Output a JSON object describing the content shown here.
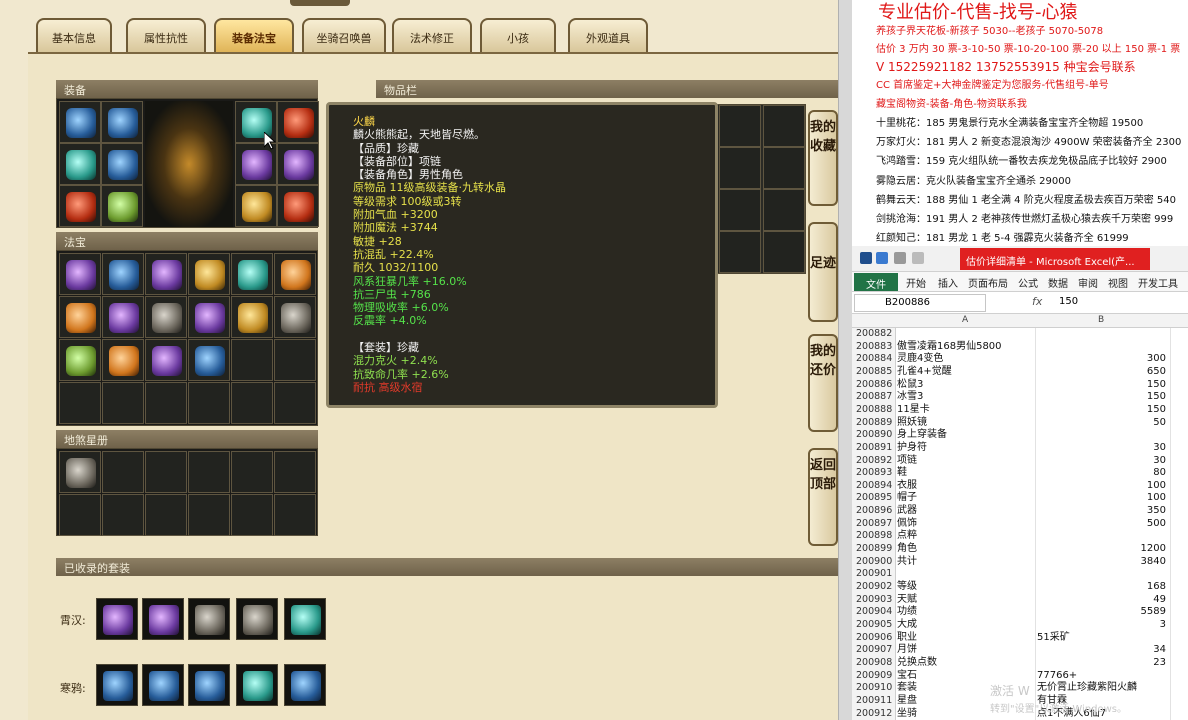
{
  "game": {
    "tabs": [
      "基本信息",
      "属性抗性",
      "装备法宝",
      "坐骑召唤兽",
      "法术修正",
      "小孩",
      "外观道具"
    ],
    "active_tab": 2,
    "sections": {
      "equip": "装备",
      "inventory": "物品栏",
      "fabao": "法宝",
      "star": "地煞星册",
      "suits": "已收录的套装"
    },
    "side_buttons": [
      "我的收藏",
      "足迹",
      "我的还价",
      "返回顶部"
    ],
    "suit_rows": [
      {
        "label": "霄汉:",
        "icons": [
          "purple",
          "purple",
          "grey",
          "grey",
          "teal"
        ]
      },
      {
        "label": "寒鸦:",
        "icons": [
          "blue",
          "blue",
          "blue",
          "teal",
          "blue"
        ]
      }
    ],
    "tooltip": [
      {
        "text": "火麟",
        "color": "y"
      },
      {
        "text": "麟火熊熊起，天地皆尽燃。",
        "color": "w"
      },
      {
        "text": "【品质】珍藏",
        "color": "w"
      },
      {
        "text": "【装备部位】项链",
        "color": "w"
      },
      {
        "text": "【装备角色】男性角色",
        "color": "w"
      },
      {
        "text": "原物品 11级高级装备·九转水晶",
        "color": "yel"
      },
      {
        "text": "等级需求 100级或3转",
        "color": "yel"
      },
      {
        "text": "附加气血 +3200",
        "color": "yel"
      },
      {
        "text": "附加魔法 +3744",
        "color": "yel"
      },
      {
        "text": "敏捷 +28",
        "color": "yel"
      },
      {
        "text": "抗混乱 +22.4%",
        "color": "yel"
      },
      {
        "text": "耐久 1032/1100",
        "color": "yel"
      },
      {
        "text": "风系狂暴几率 +16.0%",
        "color": "g"
      },
      {
        "text": "抗三尸虫 +786",
        "color": "g"
      },
      {
        "text": "物理吸收率 +6.0%",
        "color": "g"
      },
      {
        "text": "反震率 +4.0%",
        "color": "g"
      },
      {
        "text": "",
        "color": "w"
      },
      {
        "text": "【套装】珍藏",
        "color": "w"
      },
      {
        "text": "混力克火 +2.4%",
        "color": "gs"
      },
      {
        "text": "抗致命几率 +2.6%",
        "color": "gs"
      },
      {
        "text": "耐抗 高级水宿",
        "color": "r"
      }
    ]
  },
  "doc": {
    "heading": "专业估价-代售-找号-心猿",
    "lines": [
      {
        "text": "养孩子界天花板-新孩子 5030--老孩子 5070-5078",
        "style": "red"
      },
      {
        "text": "估价 3 万内 30 票-3-10-50 票-10-20-100 票-20 以上 150 票-1 票",
        "style": "red"
      },
      {
        "text": "V 15225921182    13752553915   种宝会号联系",
        "style": "red"
      },
      {
        "text": "CC 首席鉴定+大神金牌鉴定为您服务-代售组号-单号",
        "style": "red"
      },
      {
        "text": "藏宝阁物资-装备-角色-物资联系我",
        "style": "red"
      },
      {
        "text": "十里桃花：185 男鬼景行克水全满装备宝宝齐全物超 19500",
        "style": "blk"
      },
      {
        "text": "万家灯火：181 男人 2 新变态混浪淘沙 4900W 荣密装备齐全 2300",
        "style": "blk"
      },
      {
        "text": "飞鸿踏雪：159 克火组队统一番牧去疾龙免极品底子比较好 2900",
        "style": "blk"
      },
      {
        "text": "雾隐云居：克火队装备宝宝齐全通杀 29000",
        "style": "blk"
      },
      {
        "text": "鹤舞云天：188 男仙 1 老全满 4 阶克火程度孟极去疾百万荣密 540",
        "style": "blk"
      },
      {
        "text": "剑挑沧海：191 男人 2 老神孩传世燃灯孟极心猿去疾千万荣密 999",
        "style": "blk"
      },
      {
        "text": "红颜知己：181 男龙 1 老 5-4 强霹克火装备齐全 61999",
        "style": "blk"
      }
    ]
  },
  "excel": {
    "title": "估价详细清单 - Microsoft Excel(产...",
    "ribbon": [
      "开始",
      "插入",
      "页面布局",
      "公式",
      "数据",
      "审阅",
      "视图",
      "开发工具"
    ],
    "file_tab": "文件",
    "namebox": "B200886",
    "fx": "fx",
    "formula": "150",
    "col_a": "A",
    "col_b": "B",
    "rows": [
      {
        "n": "200882",
        "a": "",
        "b": ""
      },
      {
        "n": "200883",
        "a": "傲雪凌霜168男仙5800",
        "b": ""
      },
      {
        "n": "200884",
        "a": "灵鹿4变色",
        "b": "300"
      },
      {
        "n": "200885",
        "a": "孔雀4+觉醒",
        "b": "650"
      },
      {
        "n": "200886",
        "a": "松鼠3",
        "b": "150"
      },
      {
        "n": "200887",
        "a": "冰雪3",
        "b": "150"
      },
      {
        "n": "200888",
        "a": "11星卡",
        "b": "150"
      },
      {
        "n": "200889",
        "a": "照妖镜",
        "b": "50"
      },
      {
        "n": "200890",
        "a": "身上穿装备",
        "b": ""
      },
      {
        "n": "200891",
        "a": "护身符",
        "b": "30"
      },
      {
        "n": "200892",
        "a": "项链",
        "b": "30"
      },
      {
        "n": "200893",
        "a": "鞋",
        "b": "80"
      },
      {
        "n": "200894",
        "a": "衣服",
        "b": "100"
      },
      {
        "n": "200895",
        "a": "帽子",
        "b": "100"
      },
      {
        "n": "200896",
        "a": "武器",
        "b": "350"
      },
      {
        "n": "200897",
        "a": "佩饰",
        "b": "500"
      },
      {
        "n": "200898",
        "a": "点粹",
        "b": ""
      },
      {
        "n": "200899",
        "a": "角色",
        "b": "1200"
      },
      {
        "n": "200900",
        "a": "共计",
        "b": "3840"
      },
      {
        "n": "200901",
        "a": "",
        "b": ""
      },
      {
        "n": "200902",
        "a": "等级",
        "b": "168"
      },
      {
        "n": "200903",
        "a": "天赋",
        "b": "49"
      },
      {
        "n": "200904",
        "a": "功绩",
        "b": "5589"
      },
      {
        "n": "200905",
        "a": "大成",
        "b": "3"
      },
      {
        "n": "200906",
        "a": "职业",
        "bl": "51采矿"
      },
      {
        "n": "200907",
        "a": "月饼",
        "b": "34"
      },
      {
        "n": "200908",
        "a": "兑换点数",
        "b": "23"
      },
      {
        "n": "200909",
        "a": "宝石",
        "bl": "77766+"
      },
      {
        "n": "200910",
        "a": "套装",
        "bl": "无价霄止珍藏紫阳火麟"
      },
      {
        "n": "200911",
        "a": "星盘",
        "bl": "有甘霖"
      },
      {
        "n": "200912",
        "a": "坐骑",
        "bl": "点1不满人6仙7"
      }
    ],
    "watermark_1": "激活 W",
    "watermark_2": "转到\"设置\"以激活 Windows。"
  }
}
